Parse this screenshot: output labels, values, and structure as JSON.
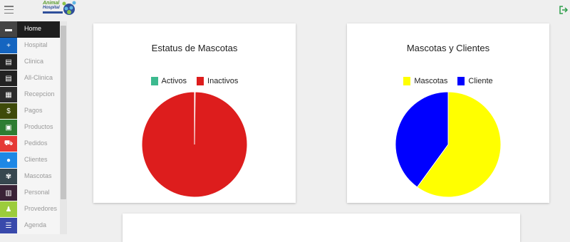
{
  "header": {
    "menu_icon": "hamburger-icon",
    "logo_line1": "Animal",
    "logo_line2": "Hospital",
    "logout_icon": "logout-icon"
  },
  "sidebar": {
    "items": [
      {
        "label": "Home",
        "icon": "home-icon",
        "color": "#444444",
        "active": true
      },
      {
        "label": "Hospital",
        "icon": "plus-icon",
        "color": "#1565c0"
      },
      {
        "label": "Clinica",
        "icon": "clipboard-icon",
        "color": "#222222"
      },
      {
        "label": "All-Clinica",
        "icon": "clipboard-icon",
        "color": "#222222"
      },
      {
        "label": "Recepcion",
        "icon": "desk-icon",
        "color": "#2b2b2b"
      },
      {
        "label": "Pagos",
        "icon": "dollar-icon",
        "color": "#3e4a0a"
      },
      {
        "label": "Productos",
        "icon": "box-icon",
        "color": "#2e7d32"
      },
      {
        "label": "Pedidos",
        "icon": "cart-icon",
        "color": "#e53935"
      },
      {
        "label": "Clientes",
        "icon": "person-icon",
        "color": "#1e88e5"
      },
      {
        "label": "Mascotas",
        "icon": "paw-icon",
        "color": "#37474f"
      },
      {
        "label": "Personal",
        "icon": "chart-icon",
        "color": "#3a2236"
      },
      {
        "label": "Provedores",
        "icon": "worker-icon",
        "color": "#9ccc3c"
      },
      {
        "label": "Agenda",
        "icon": "agenda-icon",
        "color": "#3949ab"
      }
    ]
  },
  "chart_data": [
    {
      "type": "pie",
      "title": "Estatus de Mascotas",
      "categories": [
        "Activos",
        "Inactivos"
      ],
      "values": [
        0.2,
        99.8
      ],
      "colors": [
        "#3cba8f",
        "#dd1d1d"
      ],
      "legend_position": "top"
    },
    {
      "type": "pie",
      "title": "Mascotas y Clientes",
      "categories": [
        "Mascotas",
        "Cliente"
      ],
      "values": [
        60,
        40
      ],
      "colors": [
        "#ffff00",
        "#0000ff"
      ],
      "legend_position": "top"
    }
  ]
}
